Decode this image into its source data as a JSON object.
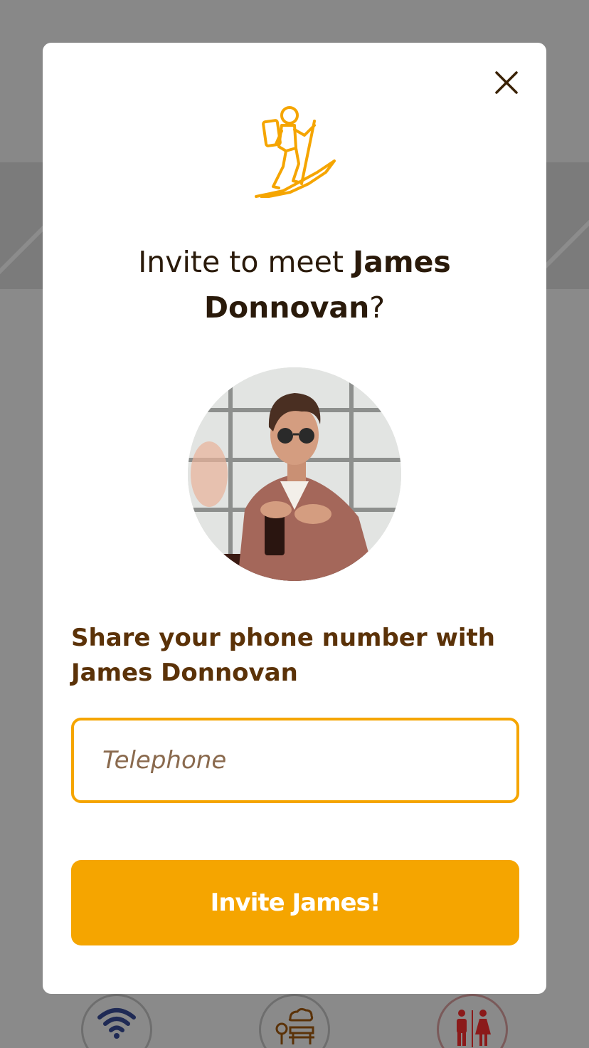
{
  "modal": {
    "title_prefix": "Invite to meet ",
    "title_name": "James Donnovan",
    "title_suffix": "?",
    "share_text": "Share your phone number with James Donnovan",
    "phone_placeholder": "Telephone",
    "phone_value": "",
    "invite_button_label": "Invite James!"
  },
  "amenities": [
    {
      "icon": "wifi-icon",
      "color": "#1f2a55"
    },
    {
      "icon": "park-bench-icon",
      "color": "#5b3208"
    },
    {
      "icon": "restroom-icon",
      "color": "#8b1a1a"
    }
  ],
  "colors": {
    "accent": "#f5a500",
    "text_brown": "#5b3208",
    "text_dark": "#2a1a0a",
    "overlay": "#8a8a8a"
  }
}
